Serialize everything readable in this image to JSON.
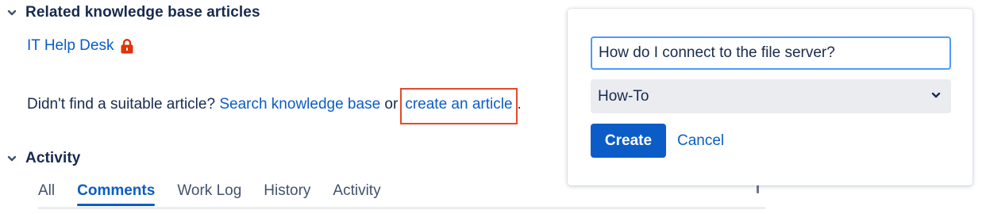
{
  "kb_section": {
    "title": "Related knowledge base articles",
    "space_link": "IT Help Desk",
    "sentence_prefix": "Didn't find a suitable article?",
    "search_link": "Search knowledge base",
    "or_text": "or",
    "create_link": "create an article",
    "period": "."
  },
  "activity_section": {
    "title": "Activity",
    "tabs": [
      {
        "label": "All",
        "active": false
      },
      {
        "label": "Comments",
        "active": true
      },
      {
        "label": "Work Log",
        "active": false
      },
      {
        "label": "History",
        "active": false
      },
      {
        "label": "Activity",
        "active": false
      }
    ]
  },
  "popup": {
    "title_value": "How do I connect to the file server?",
    "type_selected": "How-To",
    "create_label": "Create",
    "cancel_label": "Cancel"
  },
  "icons": {
    "section_toggle": "chevron-down-icon",
    "restricted": "lock-icon",
    "select_arrow": "chevron-down-icon"
  },
  "colors": {
    "link": "#0b5cc7",
    "primary_button": "#0b5cc7",
    "lock": "#de350b",
    "highlight_box": "#e34a2c",
    "focus_border": "#4c9aff",
    "select_bg": "#ebecf0",
    "text": "#172b4d"
  }
}
